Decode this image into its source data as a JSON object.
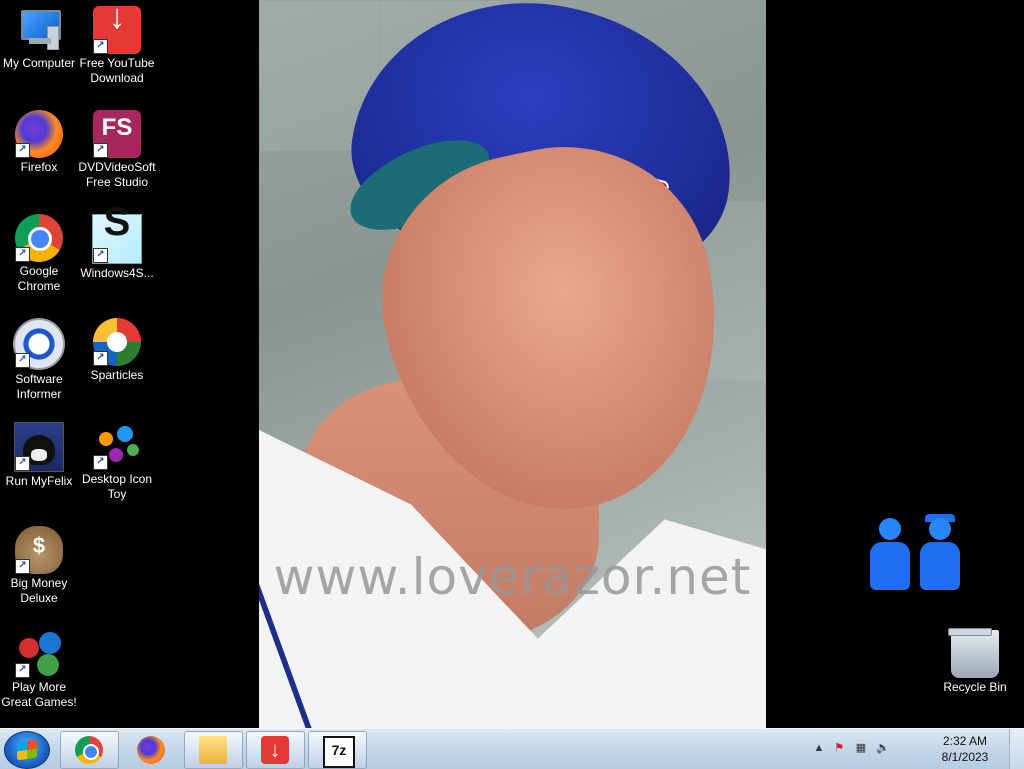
{
  "wallpaper": {
    "watermark": "www.loverazor.net"
  },
  "desktop_icons": [
    {
      "label": "My Computer",
      "icon": "computer-icon"
    },
    {
      "label": "Free YouTube Download",
      "icon": "download-arrow-icon",
      "glyph": "↓"
    },
    {
      "label": "Firefox",
      "icon": "firefox-icon"
    },
    {
      "label": "DVDVideoSoft Free Studio",
      "icon": "fs-icon",
      "glyph": "FS"
    },
    {
      "label": "Google Chrome",
      "icon": "chrome-icon"
    },
    {
      "label": "Windows4S...",
      "icon": "s-icon",
      "glyph": "S"
    },
    {
      "label": "Software Informer",
      "icon": "software-informer-icon"
    },
    {
      "label": "Sparticles",
      "icon": "sparticles-icon"
    },
    {
      "label": "Run MyFelix",
      "icon": "cat-icon"
    },
    {
      "label": "Desktop Icon Toy",
      "icon": "desktop-icon-toy-icon"
    },
    {
      "label": "Big Money Deluxe",
      "icon": "money-bag-icon",
      "glyph": "$"
    },
    {
      "label": "Play More Great Games!",
      "icon": "games-icon"
    },
    {
      "label": "Recycle Bin",
      "icon": "recycle-bin-icon"
    }
  ],
  "taskbar": {
    "buttons": [
      {
        "name": "chrome",
        "icon": "chrome-icon"
      },
      {
        "name": "firefox",
        "icon": "firefox-icon"
      },
      {
        "name": "file-explorer",
        "icon": "folder-icon"
      },
      {
        "name": "free-youtube-download",
        "icon": "download-arrow-icon",
        "glyph": "↓"
      },
      {
        "name": "7zip",
        "icon": "7zip-icon",
        "glyph": "7z"
      }
    ],
    "tray": {
      "show_hidden": "▲",
      "flag": "⚑",
      "network": "▦",
      "volume": "🔈"
    },
    "clock": {
      "time": "2:32 AM",
      "date": "8/1/2023"
    }
  },
  "colors": {
    "taskbar_top": "#dbe7f3",
    "taskbar_bottom": "#b5cbe2",
    "desktop_bg": "#000000",
    "cap_blue": "#1f2f9e"
  }
}
